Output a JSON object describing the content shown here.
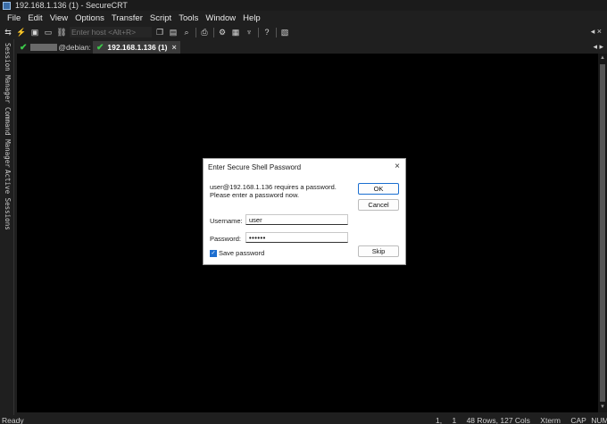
{
  "window": {
    "title": "192.168.1.136 (1) - SecureCRT"
  },
  "menu": [
    "File",
    "Edit",
    "View",
    "Options",
    "Transfer",
    "Script",
    "Tools",
    "Window",
    "Help"
  ],
  "toolbar": {
    "host_placeholder": "Enter host <Alt+R>",
    "help_label": "?",
    "pin_label": "◂ ×"
  },
  "side_panels": [
    "Session Manager",
    "Command Manager",
    "Active Sessions"
  ],
  "tabs": [
    {
      "host_suffix": "@debian: ~",
      "active": false
    },
    {
      "label": "192.168.1.136 (1)",
      "active": true
    }
  ],
  "tab_close": "×",
  "tabbar_right": "◂ ▸",
  "dialog": {
    "title": "Enter Secure Shell Password",
    "message_line1": "user@192.168.1.136 requires a password.",
    "message_line2": "Please enter a password now.",
    "username_label": "Username:",
    "username_value": "user",
    "password_label": "Password:",
    "password_value": "••••••",
    "save_password_label": "Save password",
    "save_password_checked": true,
    "ok_label": "OK",
    "cancel_label": "Cancel",
    "skip_label": "Skip",
    "close_label": "×"
  },
  "statusbar": {
    "left": "Ready",
    "row": "1,",
    "col": "1",
    "size": "48 Rows, 127 Cols",
    "term": "Xterm",
    "caps": "CAP",
    "num": "NUM"
  },
  "colors": {
    "chrome": "#1f1f1f",
    "terminal_bg": "#000000",
    "active_tab": "#3a3a3a",
    "check_green": "#3cc84a",
    "accent_blue": "#1e6fd0"
  }
}
